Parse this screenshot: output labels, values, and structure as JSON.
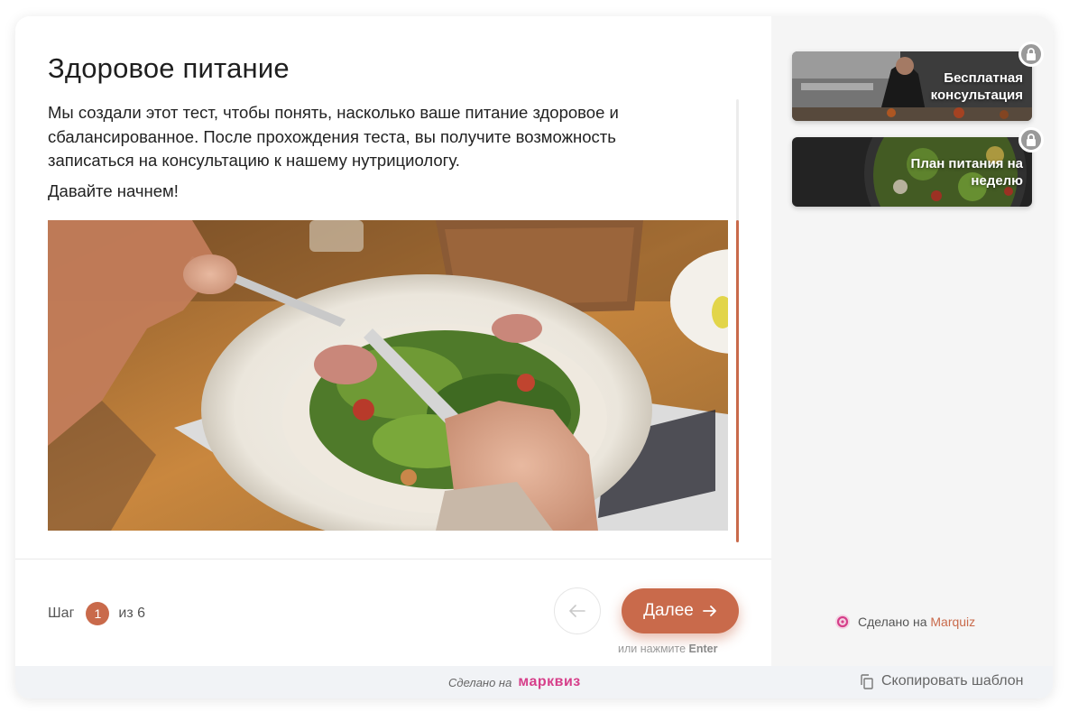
{
  "quiz": {
    "title": "Здоровое питание",
    "description": "Мы создали этот тест, чтобы понять, насколько ваше питание здоровое и сбалансированное. После прохождения теста, вы получите возможность записаться на консультацию к нашему нутрициологу.",
    "intro": "Давайте начнем!",
    "image_alt": "salad-photo"
  },
  "footer": {
    "step_label": "Шаг",
    "step_current": "1",
    "step_total": "из 6",
    "next_label": "Далее",
    "hint_prefix": "или нажмите",
    "hint_key": "Enter"
  },
  "sidebar": {
    "gifts": [
      {
        "label": "Бесплатная консультация",
        "icon": "lock-icon"
      },
      {
        "label": "План питания на неделю",
        "icon": "lock-icon"
      }
    ],
    "made_prefix": "Сделано на",
    "made_brand": "Marquiz"
  },
  "bottombar": {
    "made_prefix": "Сделано на",
    "made_brand": "марквиз",
    "copy_label": "Скопировать шаблон"
  },
  "colors": {
    "accent": "#c96a4b",
    "brand_pink": "#d63f8a",
    "sidebar_bg": "#f5f5f5"
  }
}
